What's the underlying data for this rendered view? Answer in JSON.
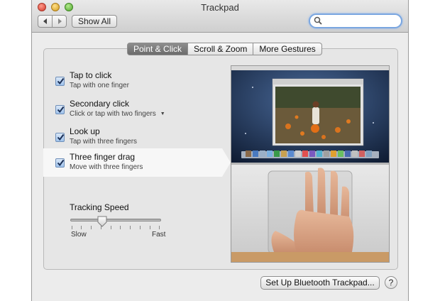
{
  "window": {
    "title": "Trackpad"
  },
  "toolbar": {
    "show_all_label": "Show All",
    "back_icon": "triangle-left",
    "forward_icon": "triangle-right"
  },
  "search": {
    "placeholder": ""
  },
  "tabs": [
    {
      "label": "Point & Click",
      "active": true
    },
    {
      "label": "Scroll & Zoom",
      "active": false
    },
    {
      "label": "More Gestures",
      "active": false
    }
  ],
  "options": [
    {
      "title": "Tap to click",
      "subtitle": "Tap with one finger",
      "checked": true,
      "selected": false
    },
    {
      "title": "Secondary click",
      "subtitle": "Click or tap with two fingers",
      "checked": true,
      "selected": false,
      "has_dropdown": true
    },
    {
      "title": "Look up",
      "subtitle": "Tap with three fingers",
      "checked": true,
      "selected": false
    },
    {
      "title": "Three finger drag",
      "subtitle": "Move with three fingers",
      "checked": true,
      "selected": true
    }
  ],
  "tracking": {
    "label": "Tracking Speed",
    "min_label": "Slow",
    "max_label": "Fast",
    "value": 0.35
  },
  "footer": {
    "setup_label": "Set Up Bluetooth Trackpad...",
    "help_label": "?"
  },
  "colors": {
    "accent": "#7aa6e0",
    "active_tab": "#7b7b7b",
    "checkbox": "#9fc2ec"
  }
}
